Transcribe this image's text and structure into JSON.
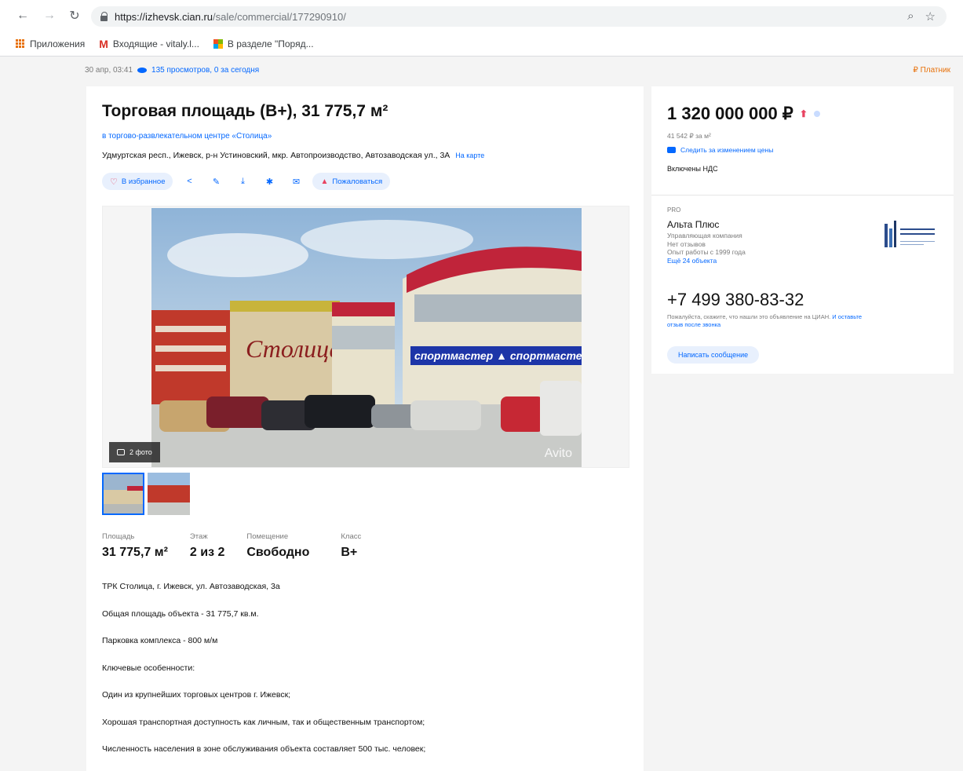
{
  "browser": {
    "url_host": "https://izhevsk.cian.ru",
    "url_path": "/sale/commercial/177290910/",
    "bookmarks": [
      "Приложения",
      "Входящие - vitaly.l...",
      "В разделе \"Поряд..."
    ]
  },
  "meta": {
    "date": "30 апр, 03:41",
    "views": "135 просмотров, 0 за сегодня",
    "complain": "Платник"
  },
  "listing": {
    "title": "Торговая площадь (B+), 31 775,7 м²",
    "complex": "в торгово-развлекательном центре «Столица»",
    "address": "Удмуртская респ., Ижевск, р-н Устиновский, мкр. Автопроизводство, Автозаводская ул., 3А",
    "on_map": "На карте",
    "favorite": "В избранное",
    "complain": "Пожаловаться",
    "photo_count": "2 фото",
    "watermark": "Avito"
  },
  "specs": [
    {
      "label": "Площадь",
      "value": "31 775,7 м²"
    },
    {
      "label": "Этаж",
      "value": "2 из 2"
    },
    {
      "label": "Помещение",
      "value": "Свободно"
    },
    {
      "label": "Класс",
      "value": "B+"
    }
  ],
  "description": [
    "ТРК Столица, г. Ижевск, ул. Автозаводская, 3а",
    "Общая площадь объекта - 31 775,7 кв.м.",
    "Парковка комплекса - 800 м/м",
    "Ключевые особенности:",
    "Один из крупнейших торговых центров г. Ижевск;",
    "Хорошая транспортная доступность как личным, так и общественным транспортом;",
    "Численность населения в зоне обслуживания объекта составляет 500 тыс. человек;"
  ],
  "price": {
    "value": "1 320 000 000 ₽",
    "per_m2": "41 542 ₽ за м²",
    "watch": "Следить за изменением цены",
    "vat": "Включены НДС"
  },
  "agent": {
    "badge": "PRO",
    "name": "Альта Плюс",
    "type": "Управляющая компания",
    "reviews": "Нет отзывов",
    "experience": "Опыт работы с 1999 года",
    "more": "Ещё 24 объекта",
    "phone": "+7 499 380-83-32",
    "note_1": "Пожалуйста, скажите, что нашли это объявление на ЦИАН.",
    "note_link": "И оставьте отзыв после звонка",
    "message": "Написать сообщение"
  }
}
